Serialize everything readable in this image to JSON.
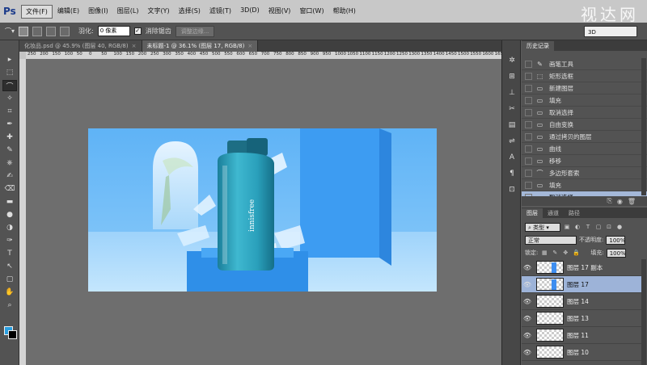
{
  "app": {
    "logo": "Ps",
    "watermark": "视达网"
  },
  "menu": [
    {
      "label": "文件(F)",
      "active": true
    },
    {
      "label": "编辑(E)"
    },
    {
      "label": "图像(I)"
    },
    {
      "label": "图层(L)"
    },
    {
      "label": "文字(Y)"
    },
    {
      "label": "选择(S)"
    },
    {
      "label": "滤镜(T)"
    },
    {
      "label": "3D(D)"
    },
    {
      "label": "视图(V)"
    },
    {
      "label": "窗口(W)"
    },
    {
      "label": "帮助(H)"
    }
  ],
  "options": {
    "feather_label": "羽化:",
    "feather_value": "0 像素",
    "antialias_label": "消除锯齿",
    "refine_button": "调整边缘...",
    "workspace": "3D"
  },
  "tabs": [
    {
      "label": "化妆品.psd @ 45.9% (图层 40, RGB/8)",
      "close": "×",
      "active": false
    },
    {
      "label": "未标题-1 @ 36.1% (图层 17, RGB/8)",
      "close": "×",
      "active": true
    }
  ],
  "ruler_ticks": [
    "250",
    "200",
    "150",
    "100",
    "50",
    "0",
    "50",
    "100",
    "150",
    "200",
    "250",
    "300",
    "350",
    "400",
    "450",
    "500",
    "550",
    "600",
    "650",
    "700",
    "750",
    "800",
    "850",
    "900",
    "950",
    "1000",
    "1050",
    "1100",
    "1150",
    "1200",
    "1250",
    "1300",
    "1350",
    "1400",
    "1450",
    "1500",
    "1550",
    "1600",
    "1650",
    "1700"
  ],
  "tools": [
    "move-icon",
    "marquee-icon",
    "lasso-icon",
    "quick-select-icon",
    "crop-icon",
    "eyedropper-icon",
    "healing-icon",
    "brush-icon",
    "stamp-icon",
    "history-brush-icon",
    "eraser-icon",
    "gradient-icon",
    "blur-icon",
    "dodge-icon",
    "pen-icon",
    "type-icon",
    "path-select-icon",
    "shape-icon",
    "hand-icon",
    "zoom-icon"
  ],
  "history": {
    "tabs": [
      "历史记录"
    ],
    "items": [
      {
        "label": "画笔工具",
        "icon": "✎"
      },
      {
        "label": "矩形选框",
        "icon": "⬚"
      },
      {
        "label": "新建图层",
        "icon": "▭"
      },
      {
        "label": "填充",
        "icon": "▭"
      },
      {
        "label": "取消选择",
        "icon": "▭"
      },
      {
        "label": "自由变换",
        "icon": "▭"
      },
      {
        "label": "通过拷贝的图层",
        "icon": "▭"
      },
      {
        "label": "曲线",
        "icon": "▭"
      },
      {
        "label": "移移",
        "icon": "▭"
      },
      {
        "label": "多边形套索",
        "icon": "⌒"
      },
      {
        "label": "填充",
        "icon": "▭"
      },
      {
        "label": "取消选择",
        "icon": "▭",
        "selected": true
      }
    ]
  },
  "layers": {
    "tabs": [
      "图层",
      "通道",
      "路径"
    ],
    "filter_kind": "类型",
    "blend_mode": "正常",
    "opacity_label": "不透明度:",
    "opacity_value": "100%",
    "lock_label": "锁定:",
    "fill_label": "填充:",
    "fill_value": "100%",
    "items": [
      {
        "name": "图层 17 副本",
        "selected": false
      },
      {
        "name": "图层 17",
        "selected": true
      },
      {
        "name": "图层 14",
        "selected": false
      },
      {
        "name": "图层 13",
        "selected": false
      },
      {
        "name": "图层 11",
        "selected": false
      },
      {
        "name": "图层 10",
        "selected": false
      }
    ]
  },
  "product": {
    "brand_text": "innisfree"
  },
  "colors": {
    "foreground": "#2a9fe0",
    "background": "#000000",
    "accent": "#a4b8d8"
  }
}
